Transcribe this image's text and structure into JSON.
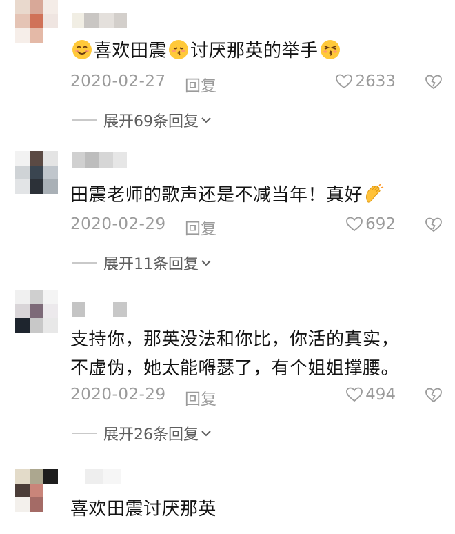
{
  "comments": [
    {
      "text_parts": [
        "喜欢田震",
        "讨厌那英的举手"
      ],
      "emojis": [
        "smile-emoji",
        "kiss-emoji",
        "kiss-wink-emoji"
      ],
      "date": "2020-02-27",
      "reply_label": "回复",
      "likes": "2633",
      "expand_label": "展开69条回复"
    },
    {
      "text": "田震老师的歌声还是不减当年！真好",
      "emojis": [
        "clapping-hands-emoji"
      ],
      "date": "2020-02-29",
      "reply_label": "回复",
      "likes": "692",
      "expand_label": "展开11条回复"
    },
    {
      "text_lines": [
        "支持你，那英没法和你比，你活的真实，",
        "不虚伪，她太能嘚瑟了，有个姐姐撑腰。"
      ],
      "date": "2020-02-29",
      "reply_label": "回复",
      "likes": "494",
      "expand_label": "展开26条回复"
    },
    {
      "text": "喜欢田震讨厌那英"
    }
  ],
  "icons": {
    "like": "heart-outline-icon",
    "dislike": "broken-heart-icon",
    "expand": "chevron-down-icon"
  },
  "colors": {
    "meta_text": "#9b9b9b",
    "expand_text": "#5e5e5e",
    "body_text": "#141414"
  }
}
